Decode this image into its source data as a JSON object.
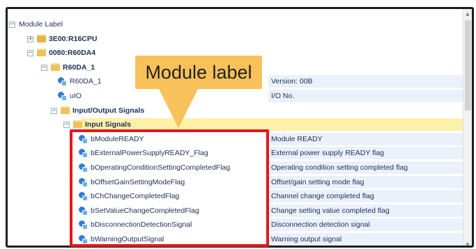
{
  "tree": {
    "root_label": "Module Label",
    "rows": [
      {
        "label": "Module Label",
        "desc": "",
        "kind": "root",
        "expander": "−"
      },
      {
        "label": "3E00:R16CPU",
        "desc": "",
        "kind": "folder",
        "expander": "+",
        "bold": true
      },
      {
        "label": "0080:R60DA4",
        "desc": "",
        "kind": "folder",
        "expander": "−",
        "bold": true
      },
      {
        "label": "R60DA_1",
        "desc": "",
        "kind": "folder",
        "expander": "−",
        "bold": true
      },
      {
        "label": "R60DA_1",
        "desc": "Version: 00B",
        "kind": "signal"
      },
      {
        "label": "uIO",
        "desc": "I/O No.",
        "kind": "signal"
      },
      {
        "label": "Input/Output Signals",
        "desc": "",
        "kind": "folder",
        "expander": "−",
        "bold": true
      },
      {
        "label": "Input Signals",
        "desc": "",
        "kind": "folder",
        "expander": "−",
        "bold": true,
        "selected": true
      },
      {
        "label": "bModuleREADY",
        "desc": "Module READY",
        "kind": "signal"
      },
      {
        "label": "bExternalPowerSupplyREADY_Flag",
        "desc": "External power supply READY flag",
        "kind": "signal"
      },
      {
        "label": "bOperatingConditionSettingCompletedFlag",
        "desc": "Operating condition setting completed flag",
        "kind": "signal"
      },
      {
        "label": "bOffsetGainSettingModeFlag",
        "desc": "Offset/gain setting mode flag",
        "kind": "signal"
      },
      {
        "label": "bChChangeCompletedFlag",
        "desc": "Channel change completed flag",
        "kind": "signal"
      },
      {
        "label": "bSetValueChangeCompletedFlag",
        "desc": "Change setting value completed flag",
        "kind": "signal"
      },
      {
        "label": "bDisconnectionDetectionSignal",
        "desc": "Disconnection detection signal",
        "kind": "signal"
      },
      {
        "label": "bWarningOutputSignal",
        "desc": "Warning output signal",
        "kind": "signal"
      }
    ]
  },
  "callout": {
    "text": "Module label",
    "color": "#f8c15a"
  },
  "highlight": {
    "color": "#e8161b"
  },
  "icons": {
    "expander": "tree-expander-icon",
    "folder": "folder-icon",
    "signal": "label-variable-icon"
  }
}
